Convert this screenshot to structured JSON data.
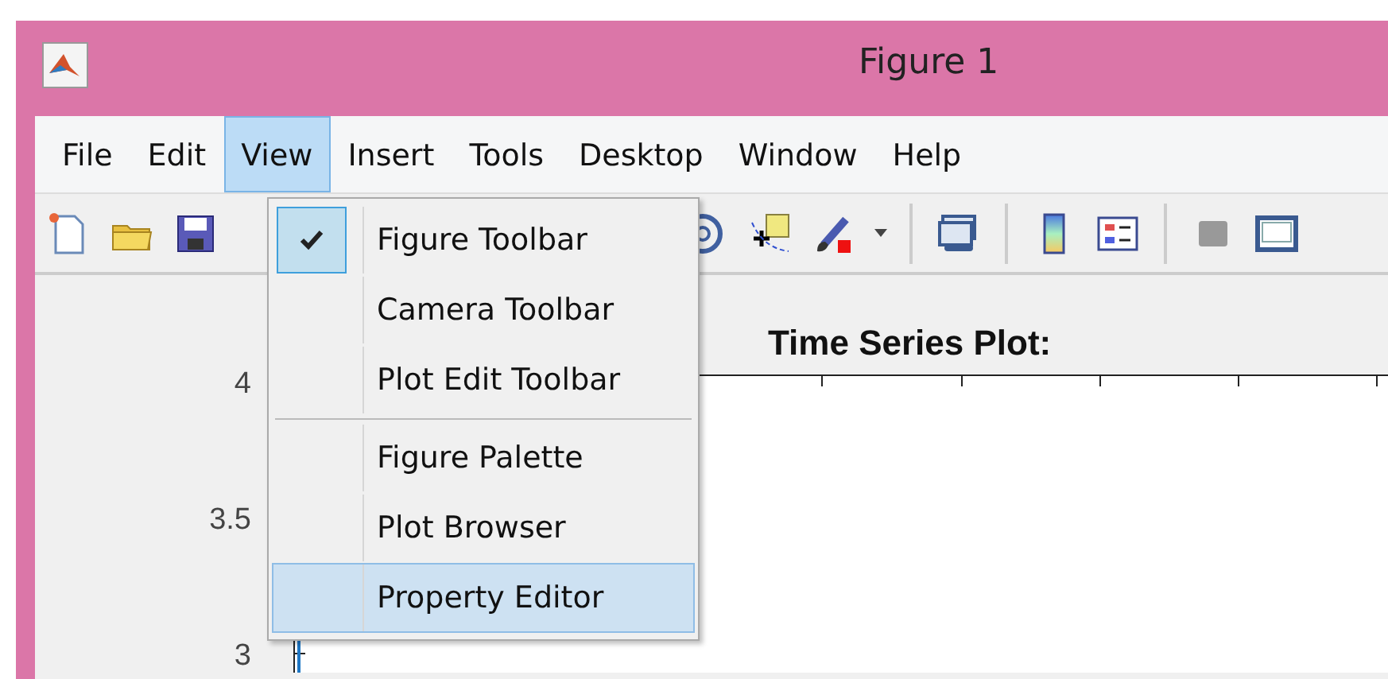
{
  "window": {
    "title": "Figure 1"
  },
  "menu_bar": [
    {
      "label": "File",
      "selected": false
    },
    {
      "label": "Edit",
      "selected": false
    },
    {
      "label": "View",
      "selected": true
    },
    {
      "label": "Insert",
      "selected": false
    },
    {
      "label": "Tools",
      "selected": false
    },
    {
      "label": "Desktop",
      "selected": false
    },
    {
      "label": "Window",
      "selected": false
    },
    {
      "label": "Help",
      "selected": false
    }
  ],
  "view_menu": {
    "sections": [
      [
        {
          "label": "Figure Toolbar",
          "checked": true,
          "selected": false
        },
        {
          "label": "Camera Toolbar",
          "checked": false,
          "selected": false
        },
        {
          "label": "Plot Edit Toolbar",
          "checked": false,
          "selected": false
        }
      ],
      [
        {
          "label": "Figure Palette",
          "checked": false,
          "selected": false
        },
        {
          "label": "Plot Browser",
          "checked": false,
          "selected": false
        },
        {
          "label": "Property Editor",
          "checked": false,
          "selected": true
        }
      ]
    ]
  },
  "plot": {
    "title": "Time Series Plot:",
    "y_tick_labels": [
      "4",
      "3.5",
      "3"
    ]
  }
}
